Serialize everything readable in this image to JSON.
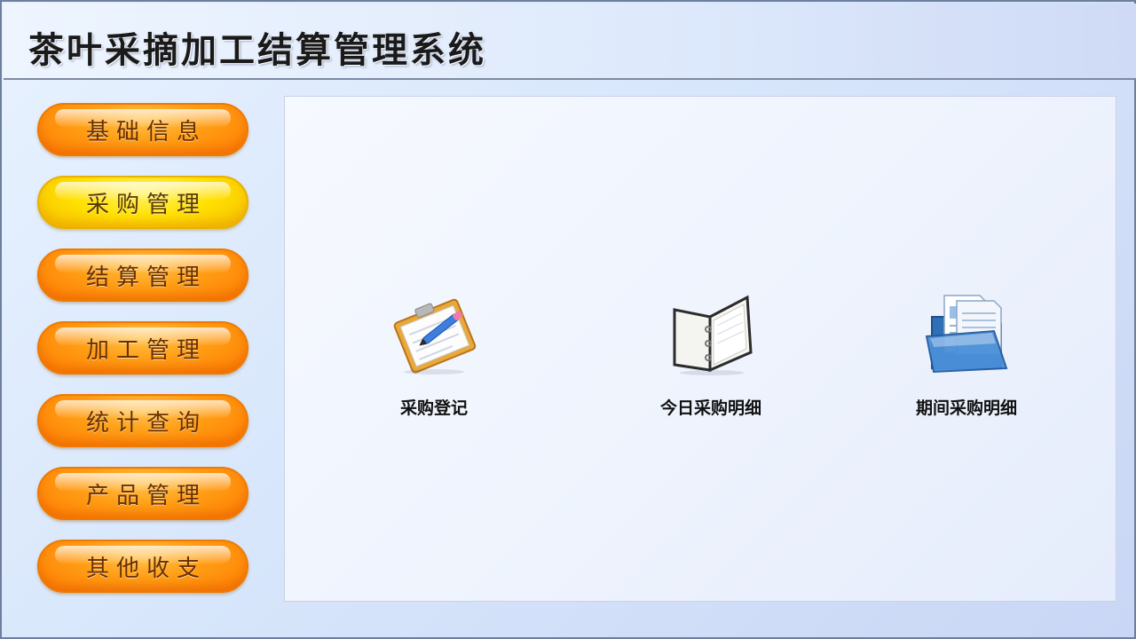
{
  "app": {
    "title": "茶叶采摘加工结算管理系统"
  },
  "sidebar": {
    "items": [
      {
        "label": "基础信息",
        "active": false
      },
      {
        "label": "采购管理",
        "active": true
      },
      {
        "label": "结算管理",
        "active": false
      },
      {
        "label": "加工管理",
        "active": false
      },
      {
        "label": "统计查询",
        "active": false
      },
      {
        "label": "产品管理",
        "active": false
      },
      {
        "label": "其他收支",
        "active": false
      }
    ]
  },
  "main": {
    "functions": [
      {
        "label": "采购登记",
        "icon": "clipboard-pen-icon"
      },
      {
        "label": "今日采购明细",
        "icon": "binder-icon"
      },
      {
        "label": "期间采购明细",
        "icon": "folder-documents-icon"
      }
    ]
  },
  "colors": {
    "accent_orange": "#ff8c00",
    "active_yellow": "#ffe000",
    "background": "#dde9fb"
  }
}
